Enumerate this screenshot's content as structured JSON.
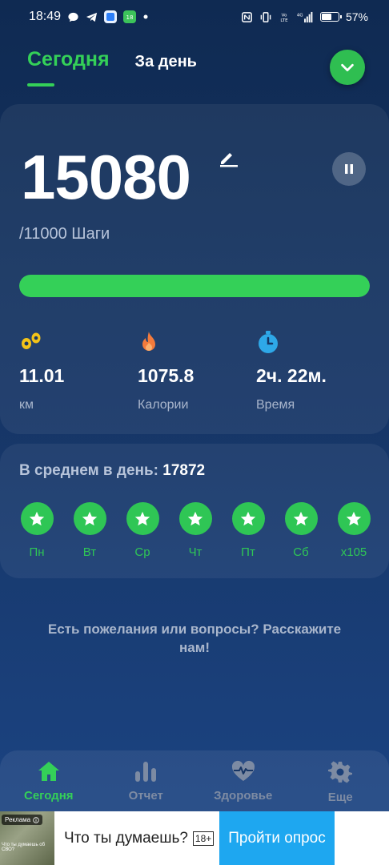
{
  "status_bar": {
    "time": "18:49",
    "battery": "57%",
    "net_label": "4G"
  },
  "tabs": {
    "today": "Сегодня",
    "day": "За день"
  },
  "steps": {
    "count": "15080",
    "goal_line": "/11000 Шаги",
    "progress_percent": 100
  },
  "stats": {
    "distance": {
      "value": "11.01",
      "unit": "км"
    },
    "calories": {
      "value": "1075.8",
      "unit": "Калории"
    },
    "time": {
      "value": "2ч. 22м.",
      "unit": "Время"
    }
  },
  "average": {
    "label": "В среднем в день:",
    "value": "17872"
  },
  "week": {
    "days": [
      "Пн",
      "Вт",
      "Ср",
      "Чт",
      "Пт",
      "Сб",
      "x105"
    ]
  },
  "feedback": "Есть пожелания или вопросы? Расскажите нам!",
  "nav": {
    "today": "Сегодня",
    "report": "Отчет",
    "health": "Здоровье",
    "more": "Еще"
  },
  "ad": {
    "badge": "Реклама",
    "thumb_caption": "Что ты думаешь об СВО?",
    "text": "Что ты думаешь?",
    "age": "18+",
    "cta": "Пройти опрос"
  },
  "colors": {
    "accent": "#34d058",
    "bg_top": "#0f2a52",
    "bg_bottom": "#1c4585",
    "ad_cta": "#1ea7f0"
  }
}
